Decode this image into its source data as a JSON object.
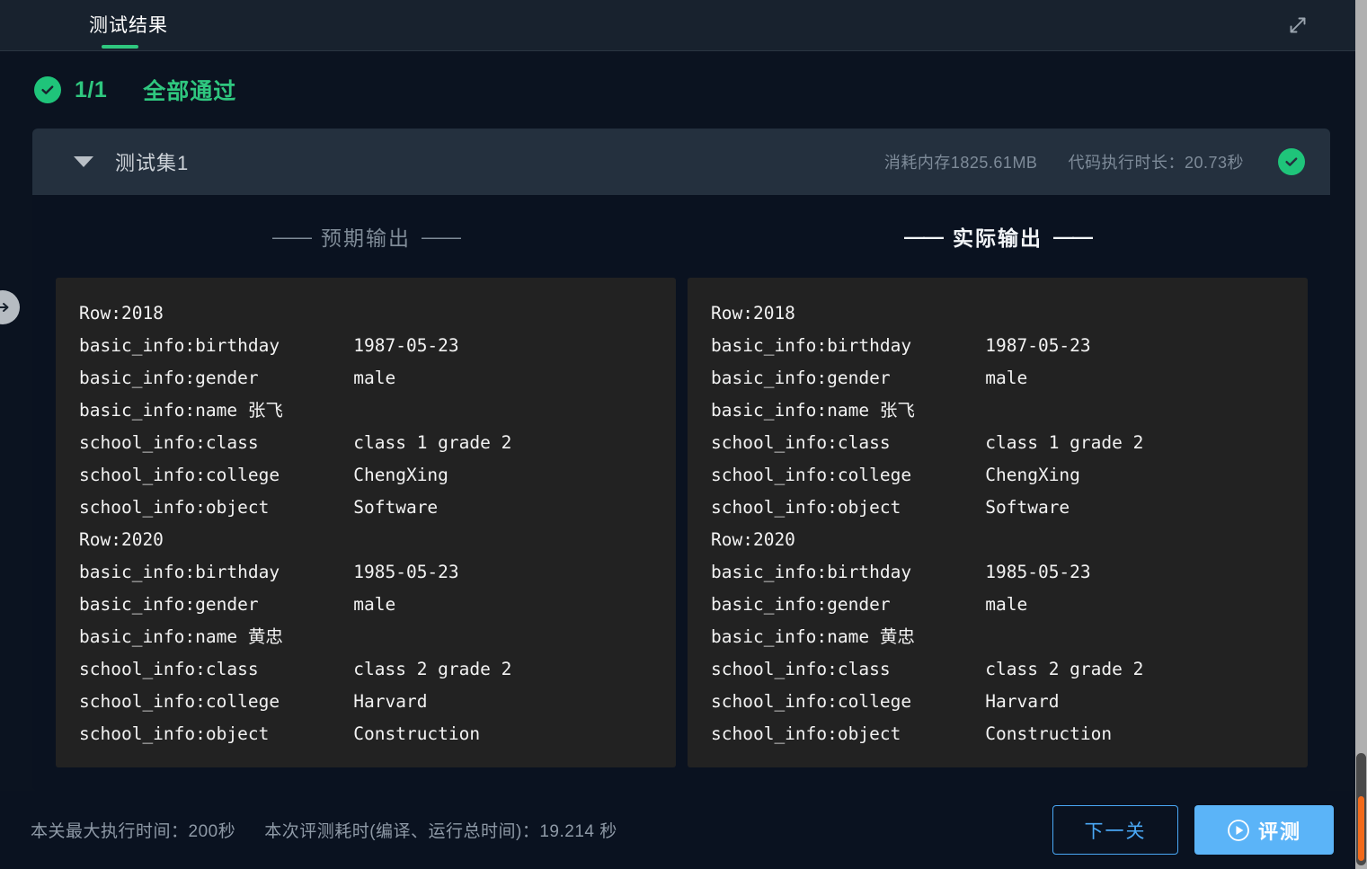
{
  "header": {
    "tab_label": "测试结果",
    "expand_icon": "expand-arrows-icon"
  },
  "summary": {
    "check_icon": "check-circle-icon",
    "count": "1/1",
    "status": "全部通过"
  },
  "testset": {
    "caret_icon": "caret-down-icon",
    "name": "测试集1",
    "memory": "消耗内存1825.61MB",
    "duration": "代码执行时长：20.73秒",
    "status_icon": "check-circle-icon"
  },
  "outputs": {
    "expected": {
      "title": "预期输出",
      "dash_left": "——",
      "dash_right": "——",
      "lines": [
        {
          "key": "Row:2018",
          "value": ""
        },
        {
          "key": "basic_info:birthday",
          "value": "1987-05-23"
        },
        {
          "key": "basic_info:gender",
          "value": "male"
        },
        {
          "key": "basic_info:name 张飞",
          "value": ""
        },
        {
          "key": "school_info:class",
          "value": "class 1 grade 2"
        },
        {
          "key": "school_info:college",
          "value": "ChengXing"
        },
        {
          "key": "school_info:object",
          "value": "Software"
        },
        {
          "key": "Row:2020",
          "value": ""
        },
        {
          "key": "basic_info:birthday",
          "value": "1985-05-23"
        },
        {
          "key": "basic_info:gender",
          "value": "male"
        },
        {
          "key": "basic_info:name 黄忠",
          "value": ""
        },
        {
          "key": "school_info:class",
          "value": "class 2 grade 2"
        },
        {
          "key": "school_info:college",
          "value": "Harvard"
        },
        {
          "key": "school_info:object",
          "value": "Construction"
        }
      ]
    },
    "actual": {
      "title": "实际输出",
      "dash_left": "——",
      "dash_right": "——",
      "lines": [
        {
          "key": "Row:2018",
          "value": ""
        },
        {
          "key": "basic_info:birthday",
          "value": "1987-05-23"
        },
        {
          "key": "basic_info:gender",
          "value": "male"
        },
        {
          "key": "basic_info:name 张飞",
          "value": ""
        },
        {
          "key": "school_info:class",
          "value": "class 1 grade 2"
        },
        {
          "key": "school_info:college",
          "value": "ChengXing"
        },
        {
          "key": "school_info:object",
          "value": "Software"
        },
        {
          "key": "Row:2020",
          "value": ""
        },
        {
          "key": "basic_info:birthday",
          "value": "1985-05-23"
        },
        {
          "key": "basic_info:gender",
          "value": "male"
        },
        {
          "key": "basic_info:name 黄忠",
          "value": ""
        },
        {
          "key": "school_info:class",
          "value": "class 2 grade 2"
        },
        {
          "key": "school_info:college",
          "value": "Harvard"
        },
        {
          "key": "school_info:object",
          "value": "Construction"
        }
      ]
    }
  },
  "footer": {
    "max_time": "本关最大执行时间：200秒",
    "elapsed": "本次评测耗时(编译、运行总时间)：19.214 秒",
    "next_button": "下一关",
    "run_button": "评测",
    "run_icon": "play-circle-icon"
  },
  "left_handle": {
    "icon": "arrow-right-icon"
  },
  "colors": {
    "accent_green": "#2fc77f",
    "accent_blue": "#5bb4f8",
    "panel_bg": "#222222",
    "card_bg": "#0a1220",
    "header_bg": "#24303e",
    "scroll_thumb_orange": "#f26a1b"
  }
}
